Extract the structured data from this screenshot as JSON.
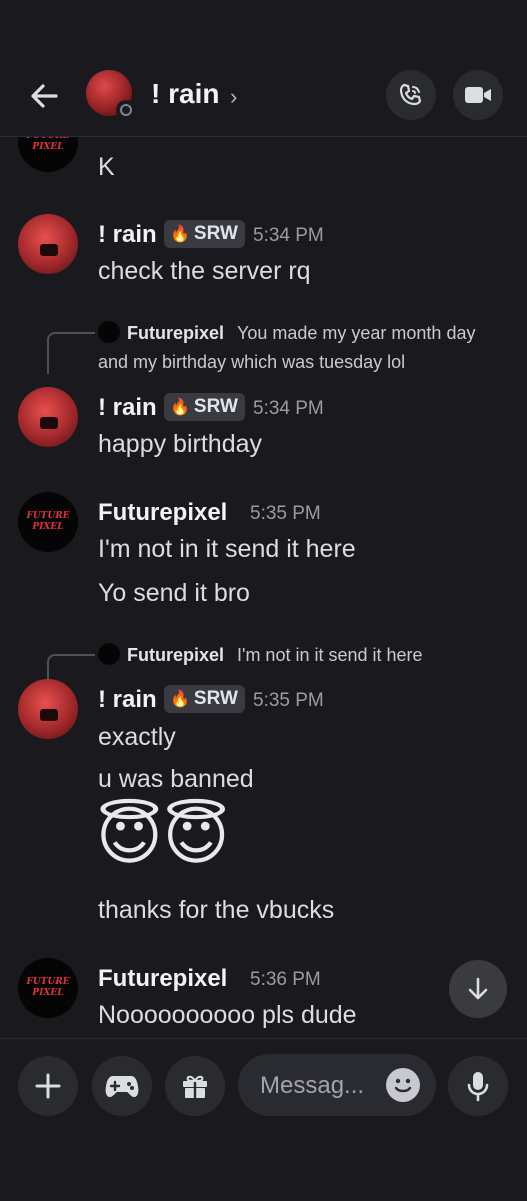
{
  "header": {
    "title": "! rain",
    "chevron": "›"
  },
  "messages": {
    "partial": {
      "text": "K"
    },
    "m1": {
      "name": "! rain",
      "tag": "SRW",
      "time": "5:34 PM",
      "line1": "check the server rq"
    },
    "m2": {
      "reply_name": "Futurepixel",
      "reply_text1": "You made my year month day",
      "reply_text2": "and my birthday which was tuesday lol",
      "name": "! rain",
      "tag": "SRW",
      "time": "5:34 PM",
      "line1": "happy birthday"
    },
    "m3": {
      "name": "Futurepixel",
      "time": "5:35 PM",
      "line1": "I'm not in it send it here",
      "line2": "Yo send it bro"
    },
    "m4": {
      "reply_name": "Futurepixel",
      "reply_text": "I'm not in it send it here",
      "name": "! rain",
      "tag": "SRW",
      "time": "5:35 PM",
      "line1": "exactly",
      "line2": "u was banned",
      "emoji": "😇😇",
      "line3": "thanks for the vbucks"
    },
    "m5": {
      "name": "Futurepixel",
      "time": "5:36 PM",
      "line1": "Noooooooooo pls dude"
    }
  },
  "avatar_text": {
    "futurepixel_line1": "FUTURE",
    "futurepixel_line2": "PIXEL"
  },
  "composer": {
    "placeholder": "Messag..."
  },
  "icons": [
    "back-arrow-icon",
    "phone-call-icon",
    "video-camera-icon",
    "plus-icon",
    "gamepad-icon",
    "gift-icon",
    "smile-icon",
    "microphone-icon",
    "arrow-down-icon"
  ],
  "colors": {
    "background": "#1a1a1e",
    "badge_flame": "#ef5fa0",
    "button_bg": "#2a2b30"
  }
}
